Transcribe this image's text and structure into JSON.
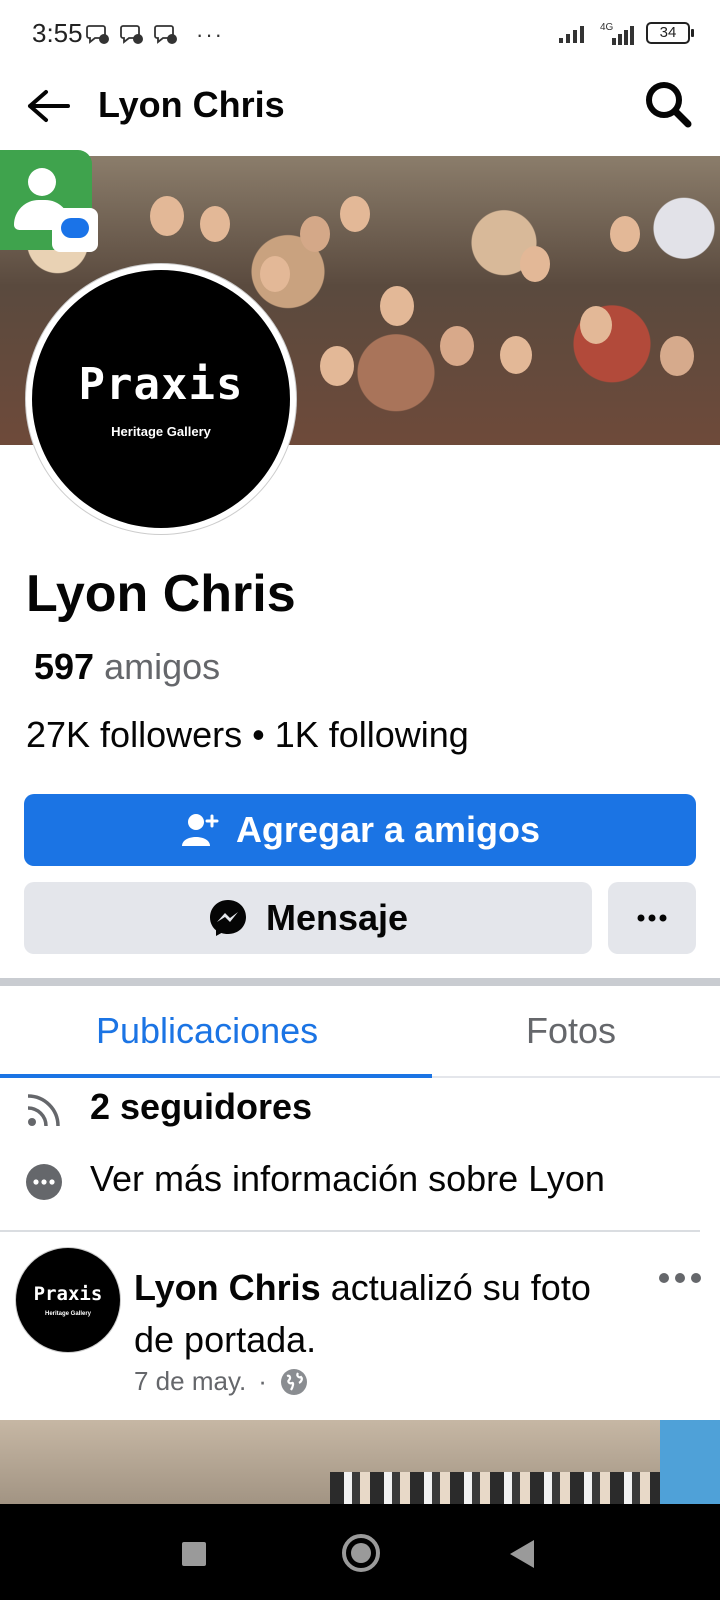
{
  "status_bar": {
    "time": "3:55",
    "dots": "···",
    "network": "4G",
    "battery": "34"
  },
  "header": {
    "title": "Lyon Chris"
  },
  "profile": {
    "avatar_logo": "Praxis",
    "avatar_subtitle": "Heritage Gallery",
    "name": "Lyon Chris",
    "friends_count": "597",
    "friends_label": "amigos",
    "follow_stats": "27K followers • 1K following"
  },
  "actions": {
    "add_friend_label": "Agregar a amigos",
    "message_label": "Mensaje",
    "more_label": "···"
  },
  "tabs": [
    {
      "label": "Publicaciones",
      "active": true
    },
    {
      "label": "Fotos",
      "active": false
    }
  ],
  "info": {
    "followers_text": "2 seguidores",
    "more_info_text": "Ver más información sobre Lyon"
  },
  "post": {
    "avatar_logo": "Praxis",
    "avatar_subtitle": "Heritage Gallery",
    "author": "Lyon Chris",
    "action_text": " actualizó su foto de portada.",
    "date": "7 de may.",
    "separator": "·"
  },
  "colors": {
    "accent": "#1b74e4",
    "secondary_button": "#e4e6eb",
    "muted_text": "#65676b"
  }
}
